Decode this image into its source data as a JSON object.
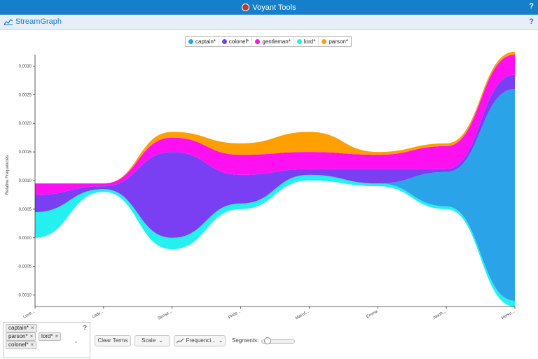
{
  "app": {
    "title": "Voyant Tools",
    "help": "?"
  },
  "panel": {
    "title": "StreamGraph",
    "help": "?"
  },
  "legend": [
    {
      "label": "captain*",
      "color": "#2ba3e8"
    },
    {
      "label": "colonel*",
      "color": "#7a3ff2"
    },
    {
      "label": "gentleman*",
      "color": "#ff10f0"
    },
    {
      "label": "lord*",
      "color": "#24f0f0"
    },
    {
      "label": "parson*",
      "color": "#ffa000"
    }
  ],
  "chart_data": {
    "type": "area",
    "ylabel": "Relative Frequencies",
    "ylim": [
      -0.0012,
      0.0032
    ],
    "yticks": [
      "0.0030",
      "0.0025",
      "0.0020",
      "0.0015",
      "0.0010",
      "0.0005",
      "0.0000",
      "-0.0005",
      "-0.0010"
    ],
    "categories": [
      "Love...",
      "Lady...",
      "Sense...",
      "Pride...",
      "Mansf...",
      "Emma",
      "North...",
      "Persu..."
    ],
    "series": [
      {
        "name": "lord*",
        "color": "#24f0f0",
        "values": [
          0.00045,
          5e-05,
          0.0002,
          0.0001,
          0.0001,
          5e-05,
          5e-05,
          0.0001
        ]
      },
      {
        "name": "captain*",
        "color": "#2ba3e8",
        "values": [
          0.0,
          0.0,
          0.0,
          0.0,
          0.0,
          0.0,
          0.0006,
          0.0037
        ]
      },
      {
        "name": "colonel*",
        "color": "#7a3ff2",
        "values": [
          0.0003,
          5e-05,
          0.0015,
          0.0005,
          0.0001,
          0.00025,
          5e-05,
          0.00025
        ]
      },
      {
        "name": "gentleman*",
        "color": "#ff10f0",
        "values": [
          0.0002,
          5e-05,
          0.00025,
          0.00035,
          0.0003,
          0.00025,
          0.0004,
          0.00035
        ]
      },
      {
        "name": "parson*",
        "color": "#ffa000",
        "values": [
          0.0,
          0.0,
          0.0001,
          0.0002,
          0.00035,
          5e-05,
          5e-05,
          5e-05
        ]
      }
    ]
  },
  "terms": [
    {
      "label": "captain*",
      "remove": "×"
    },
    {
      "label": "parson*",
      "remove": "×"
    },
    {
      "label": "lord*",
      "remove": "×"
    },
    {
      "label": "colonel*",
      "remove": "×"
    }
  ],
  "termbox": {
    "help": "?",
    "dropdown": "⌄"
  },
  "toolbar": {
    "clear_terms": "Clear Terms",
    "scale": "Scale",
    "frequencies": "Frequenci...",
    "segments": "Segments:"
  }
}
